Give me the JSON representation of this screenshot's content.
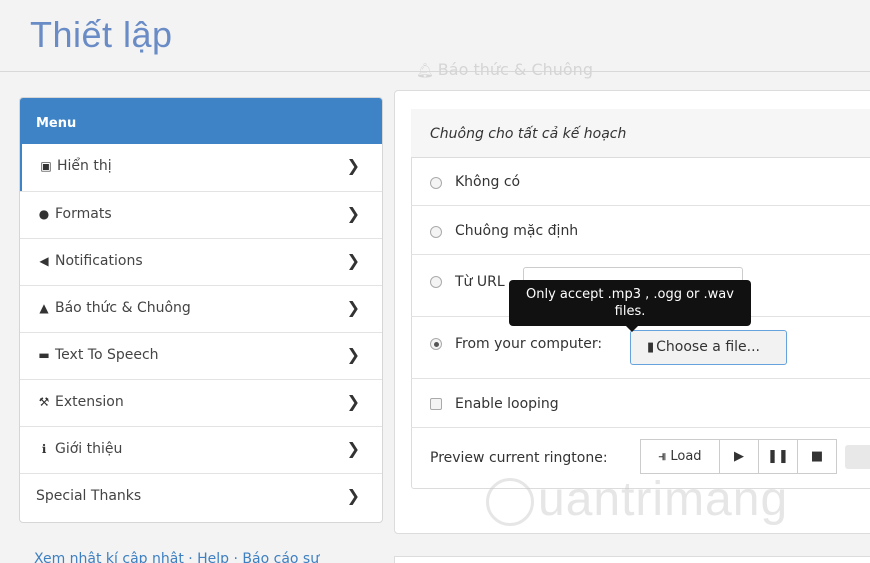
{
  "page": {
    "title": "Thiết lập"
  },
  "section": {
    "heading": "Báo thức & Chuông"
  },
  "sidebar": {
    "header": "Menu",
    "items": [
      {
        "label": "Hiển thị",
        "icon": "image-icon"
      },
      {
        "label": "Formats",
        "icon": "globe-icon"
      },
      {
        "label": "Notifications",
        "icon": "bullhorn-icon"
      },
      {
        "label": "Báo thức & Chuông",
        "icon": "bell-icon"
      },
      {
        "label": "Text To Speech",
        "icon": "comment-icon"
      },
      {
        "label": "Extension",
        "icon": "wrench-icon"
      },
      {
        "label": "Giới thiệu",
        "icon": "info-icon"
      },
      {
        "label": "Special Thanks",
        "icon": ""
      }
    ]
  },
  "footer": {
    "links": "Xem nhật kí cập nhật · Help · Báo cáo sự"
  },
  "ringtone": {
    "heading": "Chuông cho tất cả kế hoạch",
    "options": {
      "none": "Không có",
      "default": "Chuông mặc định",
      "url": "Từ URL",
      "computer": "From your computer:"
    },
    "selected": "computer",
    "tooltip": "Only accept .mp3 , .ogg or .wav files.",
    "choose_file": "Choose a file...",
    "looping": "Enable looping",
    "preview_label": "Preview current ringtone:",
    "load_button": "Load"
  },
  "watermark": "uantrimang",
  "colors": {
    "accent": "#3d83c6",
    "title": "#6a8cc6"
  }
}
